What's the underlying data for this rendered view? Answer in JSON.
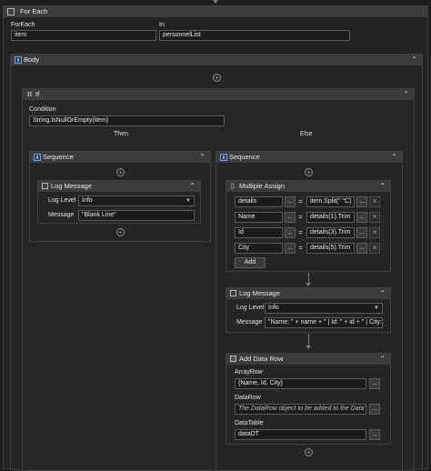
{
  "foreach": {
    "title": "For Each",
    "foreach_label": "ForEach",
    "in_label": "In",
    "item_value": "item",
    "collection_value": "personnelList"
  },
  "body": {
    "title": "Body"
  },
  "if_block": {
    "title": "If",
    "condition_label": "Condition",
    "condition_value": "String.IsNullOrEmpty(item)",
    "then_label": "Then",
    "else_label": "Else"
  },
  "then_seq": {
    "title": "Sequence",
    "log": {
      "title": "Log Message",
      "level_label": "Log Level",
      "level_value": "Info",
      "message_label": "Message",
      "message_value": "\"Blank Line\""
    }
  },
  "else_seq": {
    "title": "Sequence",
    "assign": {
      "title": "Multiple Assign",
      "rows": [
        {
          "left": "details",
          "right": "item.Split(\" \"C)"
        },
        {
          "left": "Name",
          "right": "details(1).Trim"
        },
        {
          "left": "Id",
          "right": "details(3).Trim"
        },
        {
          "left": "City",
          "right": "details(5).Trim"
        }
      ],
      "ellipsis": "...",
      "equals": "=",
      "add_label": "Add"
    },
    "log": {
      "title": "Log Message",
      "level_label": "Log Level",
      "level_value": "Info",
      "message_label": "Message",
      "message_value": "\"Name: \" + name + \" | Id: \" + id + \" | City: \""
    },
    "datarow": {
      "title": "Add Data Row",
      "arrayrow_label": "ArrayRow",
      "arrayrow_value": "{Name, Id, City}",
      "datarow_label": "DataRow",
      "datarow_placeholder": "The DataRow object to be added to the DataTable.",
      "datatable_label": "DataTable",
      "datatable_value": "dataDT",
      "ellipsis": "..."
    }
  }
}
